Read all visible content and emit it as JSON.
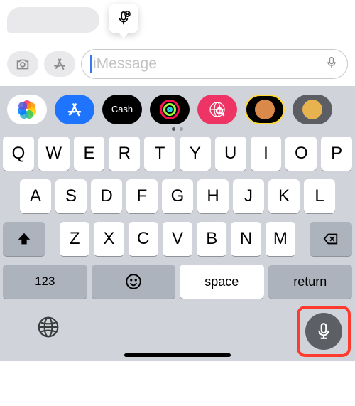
{
  "conversation": {
    "bubble_present": true
  },
  "tooltip": {
    "icon": "mic-disabled-icon"
  },
  "input": {
    "camera_icon": "camera-icon",
    "apps_icon": "app-store-icon",
    "placeholder": "iMessage",
    "mic_icon": "mic-icon"
  },
  "tray": {
    "apps": [
      {
        "id": "photos",
        "name": "photos-app-icon"
      },
      {
        "id": "appstore",
        "name": "app-store-icon"
      },
      {
        "id": "cash",
        "name": "apple-cash-icon",
        "label": "Cash"
      },
      {
        "id": "rings",
        "name": "activity-rings-icon"
      },
      {
        "id": "search",
        "name": "image-search-icon"
      },
      {
        "id": "memoji1",
        "name": "memoji-icon"
      },
      {
        "id": "memoji2",
        "name": "animoji-icon"
      }
    ],
    "indicator_active": 0,
    "indicator_count": 2
  },
  "keyboard": {
    "row1": [
      "Q",
      "W",
      "E",
      "R",
      "T",
      "Y",
      "U",
      "I",
      "O",
      "P"
    ],
    "row2": [
      "A",
      "S",
      "D",
      "F",
      "G",
      "H",
      "J",
      "K",
      "L"
    ],
    "row3": [
      "Z",
      "X",
      "C",
      "V",
      "B",
      "N",
      "M"
    ],
    "shift_icon": "shift-icon",
    "backspace_icon": "backspace-icon",
    "mode_label": "123",
    "emoji_icon": "emoji-icon",
    "space_label": "space",
    "return_label": "return"
  },
  "sysbar": {
    "globe_icon": "globe-icon",
    "dictation_icon": "dictation-mic-icon",
    "dictation_highlighted": true
  }
}
